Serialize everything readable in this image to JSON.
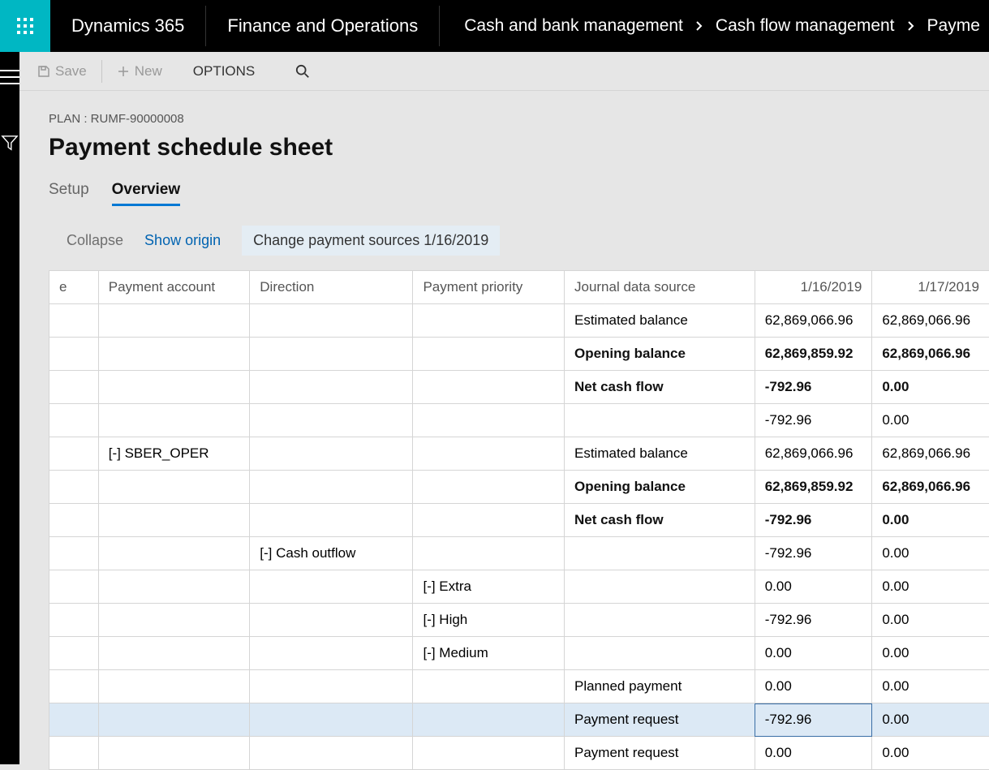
{
  "header": {
    "brand": "Dynamics 365",
    "product": "Finance and Operations",
    "breadcrumb": [
      "Cash and bank management",
      "Cash flow management",
      "Payme"
    ]
  },
  "actionbar": {
    "save": "Save",
    "new": "New",
    "options": "OPTIONS"
  },
  "page": {
    "plan_label": "PLAN : RUMF-90000008",
    "title": "Payment schedule sheet"
  },
  "tabs": {
    "setup": "Setup",
    "overview": "Overview"
  },
  "subactions": {
    "collapse": "Collapse",
    "show_origin": "Show origin",
    "change_sources": "Change payment sources 1/16/2019"
  },
  "grid": {
    "headers": {
      "type": "e",
      "account": "Payment account",
      "direction": "Direction",
      "priority": "Payment priority",
      "source": "Journal data source",
      "d1": "1/16/2019",
      "d2": "1/17/2019"
    },
    "rows": [
      {
        "account": "",
        "direction": "",
        "priority": "",
        "source": "Estimated balance",
        "d1": "62,869,066.96",
        "d2": "62,869,066.96",
        "bold": false
      },
      {
        "account": "",
        "direction": "",
        "priority": "",
        "source": "Opening balance",
        "d1": "62,869,859.92",
        "d2": "62,869,066.96",
        "bold": true
      },
      {
        "account": "",
        "direction": "",
        "priority": "",
        "source": "Net cash flow",
        "d1": "-792.96",
        "d2": "0.00",
        "bold": true
      },
      {
        "account": "",
        "direction": "",
        "priority": "",
        "source": "",
        "d1": "-792.96",
        "d2": "0.00",
        "bold": false
      },
      {
        "account": "[-] SBER_OPER",
        "direction": "",
        "priority": "",
        "source": "Estimated balance",
        "d1": "62,869,066.96",
        "d2": "62,869,066.96",
        "bold": false
      },
      {
        "account": "",
        "direction": "",
        "priority": "",
        "source": "Opening balance",
        "d1": "62,869,859.92",
        "d2": "62,869,066.96",
        "bold": true
      },
      {
        "account": "",
        "direction": "",
        "priority": "",
        "source": "Net cash flow",
        "d1": "-792.96",
        "d2": "0.00",
        "bold": true
      },
      {
        "account": "",
        "direction": "[-] Cash outflow",
        "priority": "",
        "source": "",
        "d1": "-792.96",
        "d2": "0.00",
        "bold": false
      },
      {
        "account": "",
        "direction": "",
        "priority": "[-] Extra",
        "source": "",
        "d1": "0.00",
        "d2": "0.00",
        "bold": false
      },
      {
        "account": "",
        "direction": "",
        "priority": "[-] High",
        "source": "",
        "d1": "-792.96",
        "d2": "0.00",
        "bold": false
      },
      {
        "account": "",
        "direction": "",
        "priority": "[-] Medium",
        "source": "",
        "d1": "0.00",
        "d2": "0.00",
        "bold": false
      },
      {
        "account": "",
        "direction": "",
        "priority": "",
        "source": "Planned payment",
        "d1": "0.00",
        "d2": "0.00",
        "bold": false
      },
      {
        "account": "",
        "direction": "",
        "priority": "",
        "source": "Payment request",
        "d1": "-792.96",
        "d2": "0.00",
        "bold": false,
        "selected": true
      },
      {
        "account": "",
        "direction": "",
        "priority": "",
        "source": "Payment request",
        "d1": "0.00",
        "d2": "0.00",
        "bold": false
      }
    ]
  }
}
